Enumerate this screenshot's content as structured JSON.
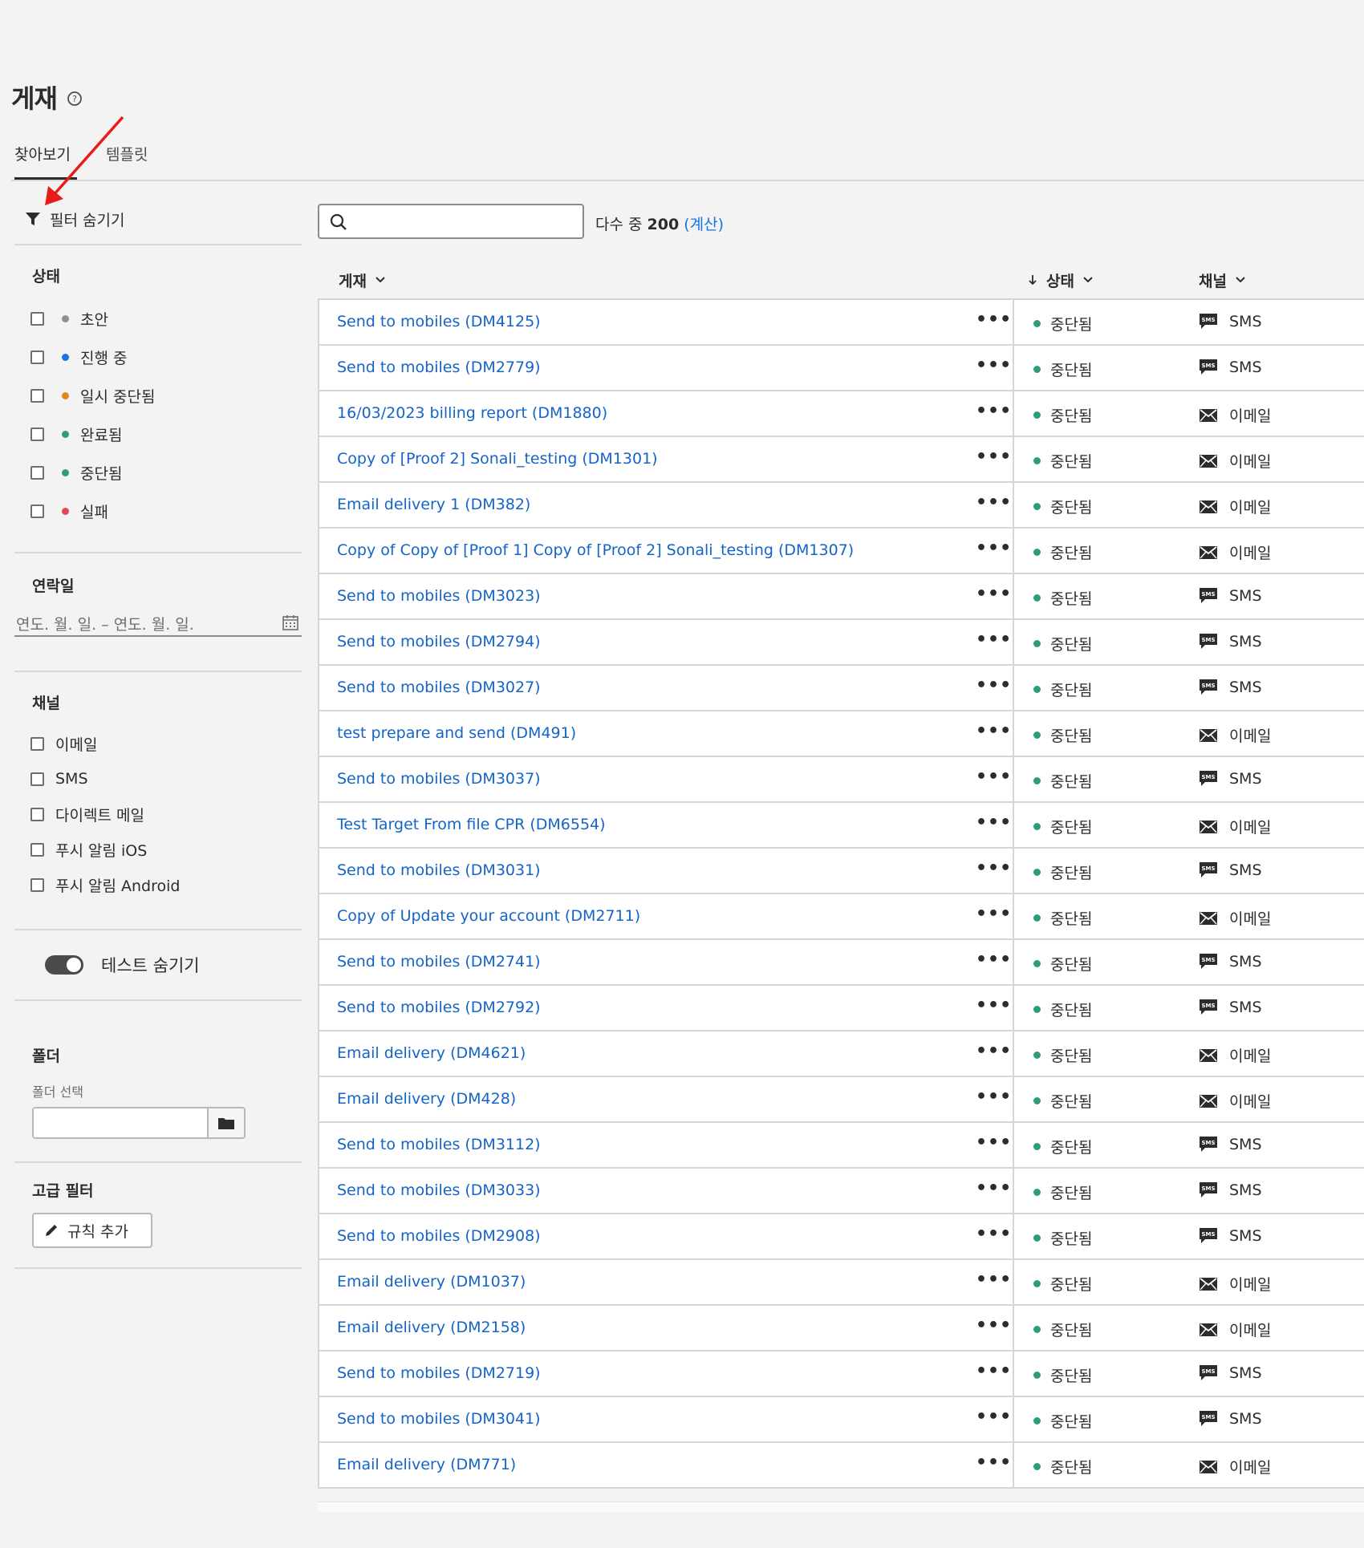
{
  "page": {
    "title": "게재"
  },
  "tabs": [
    {
      "label": "찾아보기"
    },
    {
      "label": "템플릿"
    }
  ],
  "filters": {
    "toggle_label": "필터 숨기기",
    "status": {
      "heading": "상태",
      "items": [
        {
          "label": "초안",
          "color": "#8e8e8e"
        },
        {
          "label": "진행 중",
          "color": "#1473e6"
        },
        {
          "label": "일시 중단됨",
          "color": "#e68619"
        },
        {
          "label": "완료됨",
          "color": "#2d9d78"
        },
        {
          "label": "중단됨",
          "color": "#2d9d78"
        },
        {
          "label": "실패",
          "color": "#e34850"
        }
      ]
    },
    "contact_date": {
      "heading": "연락일",
      "placeholder": "연도. 월. 일. – 연도. 월. 일."
    },
    "channel": {
      "heading": "채널",
      "items": [
        {
          "label": "이메일"
        },
        {
          "label": "SMS"
        },
        {
          "label": "다이렉트 메일"
        },
        {
          "label": "푸시 알림 iOS"
        },
        {
          "label": "푸시 알림 Android"
        }
      ]
    },
    "hide_tests_label": "테스트 숨기기",
    "folder": {
      "heading": "폴더",
      "label": "폴더 선택"
    },
    "advanced": {
      "heading": "고급 필터",
      "add_rule_label": "규칙 추가"
    }
  },
  "search": {
    "placeholder": ""
  },
  "count": {
    "prefix": "다수 중",
    "value": "200",
    "calc": "(계산)"
  },
  "table": {
    "columns": {
      "name": "게재",
      "status": "상태",
      "channel": "채널"
    },
    "rows": [
      {
        "name": "Send to mobiles (DM4125)",
        "status": "중단됨",
        "channel": "SMS"
      },
      {
        "name": "Send to mobiles (DM2779)",
        "status": "중단됨",
        "channel": "SMS"
      },
      {
        "name": "16/03/2023 billing report (DM1880)",
        "status": "중단됨",
        "channel": "이메일"
      },
      {
        "name": "Copy of [Proof 2] Sonali_testing (DM1301)",
        "status": "중단됨",
        "channel": "이메일"
      },
      {
        "name": "Email delivery 1 (DM382)",
        "status": "중단됨",
        "channel": "이메일"
      },
      {
        "name": "Copy of Copy of [Proof 1] Copy of [Proof 2] Sonali_testing (DM1307)",
        "status": "중단됨",
        "channel": "이메일"
      },
      {
        "name": "Send to mobiles (DM3023)",
        "status": "중단됨",
        "channel": "SMS"
      },
      {
        "name": "Send to mobiles (DM2794)",
        "status": "중단됨",
        "channel": "SMS"
      },
      {
        "name": "Send to mobiles (DM3027)",
        "status": "중단됨",
        "channel": "SMS"
      },
      {
        "name": "test prepare and send (DM491)",
        "status": "중단됨",
        "channel": "이메일"
      },
      {
        "name": "Send to mobiles (DM3037)",
        "status": "중단됨",
        "channel": "SMS"
      },
      {
        "name": "Test Target From file CPR (DM6554)",
        "status": "중단됨",
        "channel": "이메일"
      },
      {
        "name": "Send to mobiles (DM3031)",
        "status": "중단됨",
        "channel": "SMS"
      },
      {
        "name": "Copy of Update your account (DM2711)",
        "status": "중단됨",
        "channel": "이메일"
      },
      {
        "name": "Send to mobiles (DM2741)",
        "status": "중단됨",
        "channel": "SMS"
      },
      {
        "name": "Send to mobiles (DM2792)",
        "status": "중단됨",
        "channel": "SMS"
      },
      {
        "name": "Email delivery (DM4621)",
        "status": "중단됨",
        "channel": "이메일"
      },
      {
        "name": "Email delivery (DM428)",
        "status": "중단됨",
        "channel": "이메일"
      },
      {
        "name": "Send to mobiles (DM3112)",
        "status": "중단됨",
        "channel": "SMS"
      },
      {
        "name": "Send to mobiles (DM3033)",
        "status": "중단됨",
        "channel": "SMS"
      },
      {
        "name": "Send to mobiles (DM2908)",
        "status": "중단됨",
        "channel": "SMS"
      },
      {
        "name": "Email delivery (DM1037)",
        "status": "중단됨",
        "channel": "이메일"
      },
      {
        "name": "Email delivery (DM2158)",
        "status": "중단됨",
        "channel": "이메일"
      },
      {
        "name": "Send to mobiles (DM2719)",
        "status": "중단됨",
        "channel": "SMS"
      },
      {
        "name": "Send to mobiles (DM3041)",
        "status": "중단됨",
        "channel": "SMS"
      },
      {
        "name": "Email delivery (DM771)",
        "status": "중단됨",
        "channel": "이메일"
      }
    ]
  },
  "colors": {
    "link": "#1464c8",
    "stopped": "#2d9d78",
    "annotation": "#e81b1b"
  },
  "icons": {
    "help": "help-circle-icon",
    "filter": "funnel-icon",
    "search": "search-icon",
    "calendar": "calendar-icon",
    "folder": "folder-icon",
    "pencil": "pencil-icon",
    "sms": "sms-icon",
    "email": "email-icon",
    "more": "more-icon",
    "chevron": "chevron-down-icon",
    "sort": "sort-arrow-icon"
  }
}
